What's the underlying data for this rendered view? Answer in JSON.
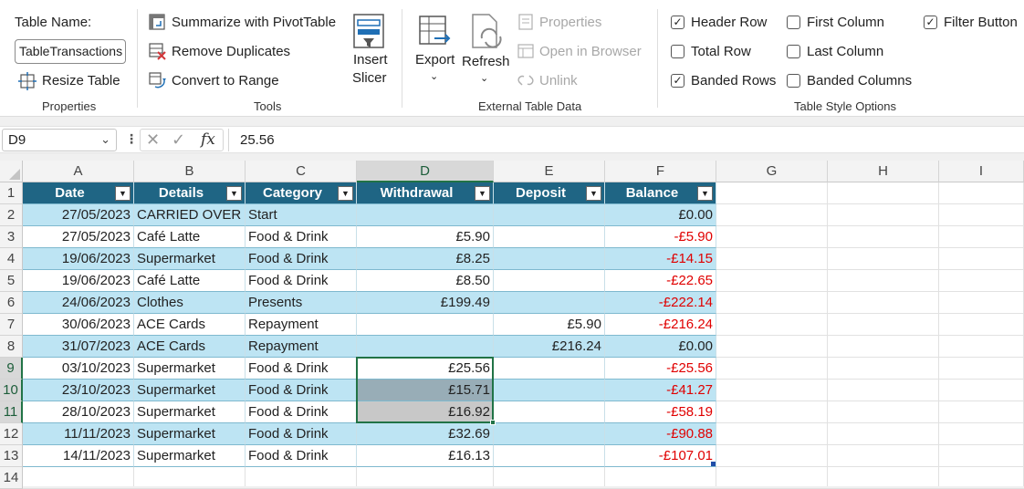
{
  "ribbon": {
    "properties": {
      "table_name_label": "Table Name:",
      "table_name_value": "TableTransactions",
      "resize_table": "Resize Table",
      "group_label": "Properties"
    },
    "tools": {
      "summarize_pivot": "Summarize with PivotTable",
      "remove_duplicates": "Remove Duplicates",
      "convert_to_range": "Convert to Range",
      "insert_slicer_line1": "Insert",
      "insert_slicer_line2": "Slicer",
      "group_label": "Tools"
    },
    "external": {
      "export": "Export",
      "refresh": "Refresh",
      "properties": "Properties",
      "open_in_browser": "Open in Browser",
      "unlink": "Unlink",
      "group_label": "External Table Data"
    },
    "style_options": {
      "header_row": "Header Row",
      "total_row": "Total Row",
      "banded_rows": "Banded Rows",
      "first_column": "First Column",
      "last_column": "Last Column",
      "banded_columns": "Banded Columns",
      "filter_button": "Filter Button",
      "header_row_checked": true,
      "total_row_checked": false,
      "banded_rows_checked": true,
      "first_column_checked": false,
      "last_column_checked": false,
      "banded_columns_checked": false,
      "filter_button_checked": true,
      "group_label": "Table Style Options"
    }
  },
  "formula_bar": {
    "name_box": "D9",
    "fx": "fx",
    "value": "25.56"
  },
  "columns": [
    "A",
    "B",
    "C",
    "D",
    "E",
    "F",
    "G",
    "H",
    "I"
  ],
  "row_numbers": [
    "1",
    "2",
    "3",
    "4",
    "5",
    "6",
    "7",
    "8",
    "9",
    "10",
    "11",
    "12",
    "13",
    "14"
  ],
  "table": {
    "headers": [
      "Date",
      "Details",
      "Category",
      "Withdrawal",
      "Deposit",
      "Balance"
    ],
    "rows": [
      [
        "27/05/2023",
        "CARRIED OVER",
        "Start",
        "",
        "",
        "£0.00"
      ],
      [
        "27/05/2023",
        "Café Latte",
        "Food & Drink",
        "£5.90",
        "",
        "-£5.90"
      ],
      [
        "19/06/2023",
        "Supermarket",
        "Food & Drink",
        "£8.25",
        "",
        "-£14.15"
      ],
      [
        "19/06/2023",
        "Café Latte",
        "Food & Drink",
        "£8.50",
        "",
        "-£22.65"
      ],
      [
        "24/06/2023",
        "Clothes",
        "Presents",
        "£199.49",
        "",
        "-£222.14"
      ],
      [
        "30/06/2023",
        "ACE Cards",
        "Repayment",
        "",
        "£5.90",
        "-£216.24"
      ],
      [
        "31/07/2023",
        "ACE Cards",
        "Repayment",
        "",
        "£216.24",
        "£0.00"
      ],
      [
        "03/10/2023",
        "Supermarket",
        "Food & Drink",
        "£25.56",
        "",
        "-£25.56"
      ],
      [
        "23/10/2023",
        "Supermarket",
        "Food & Drink",
        "£15.71",
        "",
        "-£41.27"
      ],
      [
        "28/10/2023",
        "Supermarket",
        "Food & Drink",
        "£16.92",
        "",
        "-£58.19"
      ],
      [
        "11/11/2023",
        "Supermarket",
        "Food & Drink",
        "£32.69",
        "",
        "-£90.88"
      ],
      [
        "14/11/2023",
        "Supermarket",
        "Food & Drink",
        "£16.13",
        "",
        "-£107.01"
      ]
    ]
  },
  "colors": {
    "header_fill": "#1f6584",
    "band_fill": "#bde4f3",
    "negative": "#e00000",
    "selection": "#217346"
  }
}
